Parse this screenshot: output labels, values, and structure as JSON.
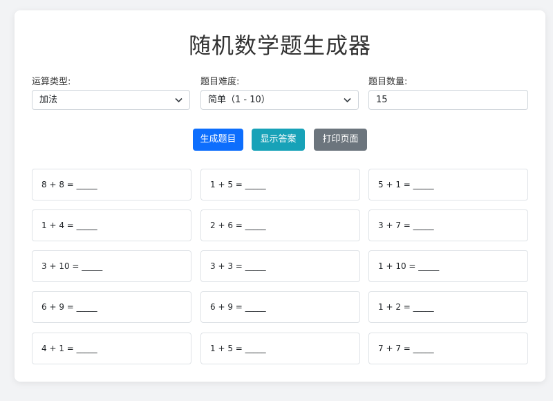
{
  "app": {
    "title": "随机数学题生成器"
  },
  "form": {
    "operation": {
      "label": "运算类型:",
      "value": "加法"
    },
    "difficulty": {
      "label": "题目难度:",
      "value": "简单（1 - 10）"
    },
    "count": {
      "label": "题目数量:",
      "value": "15"
    }
  },
  "buttons": {
    "generate": "生成题目",
    "show_answers": "显示答案",
    "print": "打印页面"
  },
  "colors": {
    "primary": "#0d6efd",
    "info": "#17a2b8",
    "secondary": "#6c757d"
  },
  "problems": [
    "8 + 8 = _____",
    "1 + 5 = _____",
    "5 + 1 = _____",
    "1 + 4 = _____",
    "2 + 6 = _____",
    "3 + 7 = _____",
    "3 + 10 = _____",
    "3 + 3 = _____",
    "1 + 10 = _____",
    "6 + 9 = _____",
    "6 + 9 = _____",
    "1 + 2 = _____",
    "4 + 1 = _____",
    "1 + 5 = _____",
    "7 + 7 = _____"
  ]
}
